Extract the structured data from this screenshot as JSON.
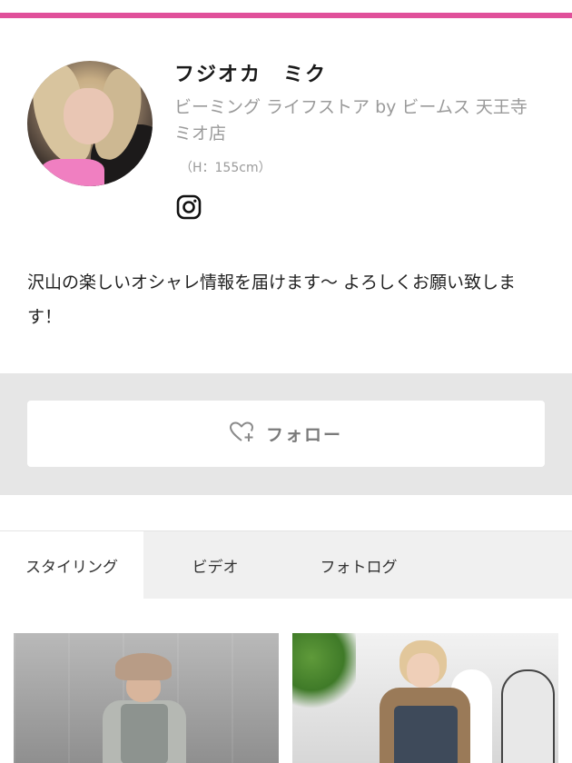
{
  "accent_color": "#e0509a",
  "profile": {
    "name": "フジオカ　ミク",
    "shop": "ビーミング ライフストア by ビームス 天王寺ミオ店",
    "height": "（H：155cm）",
    "instagram_icon": "instagram-icon",
    "bio": "沢山の楽しいオシャレ情報を届けます〜 よろしくお願い致します！"
  },
  "follow": {
    "label": "フォロー",
    "icon": "heart-plus-icon"
  },
  "tabs": [
    {
      "label": "スタイリング",
      "active": true
    },
    {
      "label": "ビデオ",
      "active": false
    },
    {
      "label": "フォトログ",
      "active": false
    }
  ]
}
